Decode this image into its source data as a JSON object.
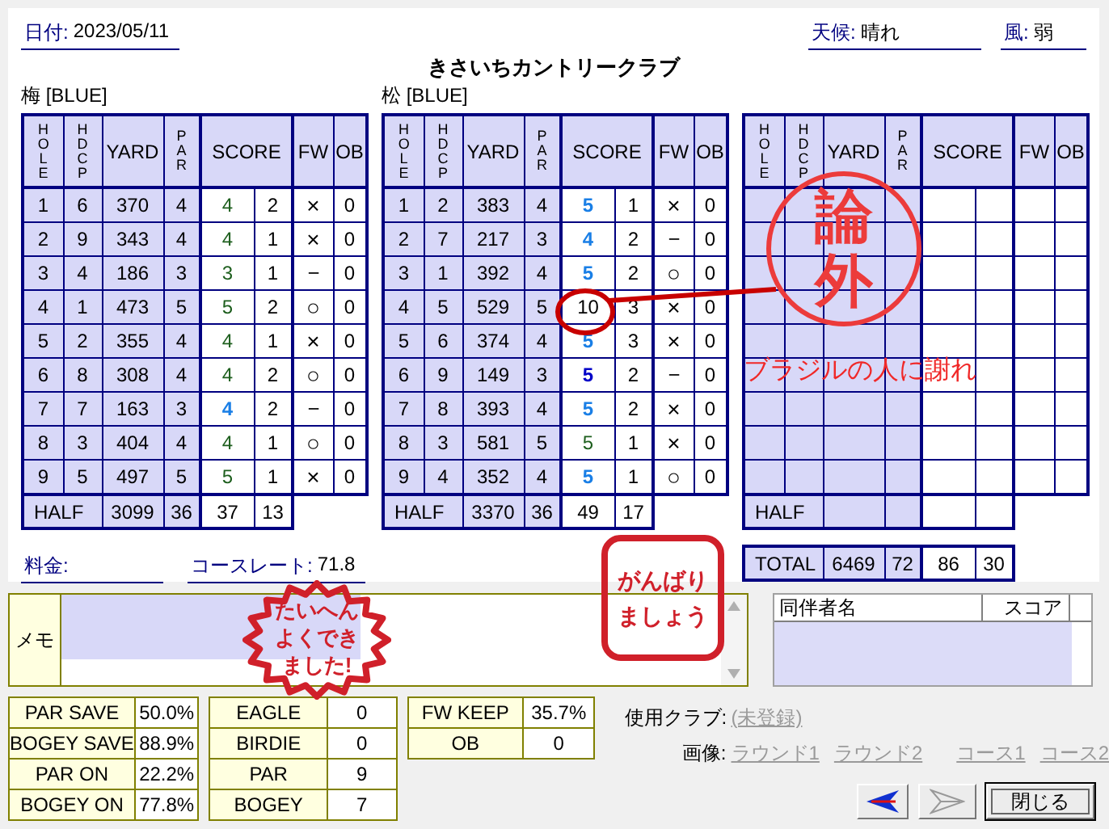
{
  "header": {
    "date_label": "日付:",
    "date": "2023/05/11",
    "weather_label": "天候:",
    "weather": "晴れ",
    "wind_label": "風:",
    "wind": "弱"
  },
  "title": "きさいちカントリークラブ",
  "courses": [
    {
      "name": "梅 [BLUE]",
      "columns": [
        {
          "label": "HOLE",
          "vertical": true
        },
        {
          "label": "HDCP",
          "vertical": true
        },
        {
          "label": "YARD",
          "vertical": false
        },
        {
          "label": "PAR",
          "vertical": true
        },
        {
          "label": "SCORE",
          "vertical": false
        },
        {
          "label": "FW",
          "vertical": false
        },
        {
          "label": "OB",
          "vertical": false
        }
      ],
      "holes": [
        {
          "hole": "1",
          "hdcp": "6",
          "yard": "370",
          "par": "4",
          "score": "4",
          "color": "#1d5e1d",
          "bold": false,
          "putts": "2",
          "fw": "×",
          "ob": "0"
        },
        {
          "hole": "2",
          "hdcp": "9",
          "yard": "343",
          "par": "4",
          "score": "4",
          "color": "#1d5e1d",
          "bold": false,
          "putts": "1",
          "fw": "×",
          "ob": "0"
        },
        {
          "hole": "3",
          "hdcp": "4",
          "yard": "186",
          "par": "3",
          "score": "3",
          "color": "#1d5e1d",
          "bold": false,
          "putts": "1",
          "fw": "－",
          "ob": "0"
        },
        {
          "hole": "4",
          "hdcp": "1",
          "yard": "473",
          "par": "5",
          "score": "5",
          "color": "#1d5e1d",
          "bold": false,
          "putts": "2",
          "fw": "○",
          "ob": "0"
        },
        {
          "hole": "5",
          "hdcp": "2",
          "yard": "355",
          "par": "4",
          "score": "4",
          "color": "#1d5e1d",
          "bold": false,
          "putts": "1",
          "fw": "×",
          "ob": "0"
        },
        {
          "hole": "6",
          "hdcp": "8",
          "yard": "308",
          "par": "4",
          "score": "4",
          "color": "#1d5e1d",
          "bold": false,
          "putts": "2",
          "fw": "○",
          "ob": "0"
        },
        {
          "hole": "7",
          "hdcp": "7",
          "yard": "163",
          "par": "3",
          "score": "4",
          "color": "#1a7fe6",
          "bold": true,
          "putts": "2",
          "fw": "－",
          "ob": "0"
        },
        {
          "hole": "8",
          "hdcp": "3",
          "yard": "404",
          "par": "4",
          "score": "4",
          "color": "#1d5e1d",
          "bold": false,
          "putts": "1",
          "fw": "○",
          "ob": "0"
        },
        {
          "hole": "9",
          "hdcp": "5",
          "yard": "497",
          "par": "5",
          "score": "5",
          "color": "#1d5e1d",
          "bold": false,
          "putts": "1",
          "fw": "×",
          "ob": "0"
        }
      ],
      "half": {
        "label": "HALF",
        "yard": "3099",
        "par": "36",
        "score": "37",
        "putts": "13"
      }
    },
    {
      "name": "松 [BLUE]",
      "columns": [
        {
          "label": "HOLE",
          "vertical": true
        },
        {
          "label": "HDCP",
          "vertical": true
        },
        {
          "label": "YARD",
          "vertical": false
        },
        {
          "label": "PAR",
          "vertical": true
        },
        {
          "label": "SCORE",
          "vertical": false
        },
        {
          "label": "FW",
          "vertical": false
        },
        {
          "label": "OB",
          "vertical": false
        }
      ],
      "holes": [
        {
          "hole": "1",
          "hdcp": "2",
          "yard": "383",
          "par": "4",
          "score": "5",
          "color": "#1a7fe6",
          "bold": true,
          "putts": "1",
          "fw": "×",
          "ob": "0"
        },
        {
          "hole": "2",
          "hdcp": "7",
          "yard": "217",
          "par": "3",
          "score": "4",
          "color": "#1a7fe6",
          "bold": true,
          "putts": "2",
          "fw": "－",
          "ob": "0"
        },
        {
          "hole": "3",
          "hdcp": "1",
          "yard": "392",
          "par": "4",
          "score": "5",
          "color": "#1a7fe6",
          "bold": true,
          "putts": "2",
          "fw": "○",
          "ob": "0"
        },
        {
          "hole": "4",
          "hdcp": "5",
          "yard": "529",
          "par": "5",
          "score": "10",
          "color": "#000000",
          "bold": false,
          "putts": "3",
          "fw": "×",
          "ob": "0"
        },
        {
          "hole": "5",
          "hdcp": "6",
          "yard": "374",
          "par": "4",
          "score": "5",
          "color": "#1a7fe6",
          "bold": true,
          "putts": "3",
          "fw": "×",
          "ob": "0"
        },
        {
          "hole": "6",
          "hdcp": "9",
          "yard": "149",
          "par": "3",
          "score": "5",
          "color": "#0000c8",
          "bold": true,
          "putts": "2",
          "fw": "－",
          "ob": "0"
        },
        {
          "hole": "7",
          "hdcp": "8",
          "yard": "393",
          "par": "4",
          "score": "5",
          "color": "#1a7fe6",
          "bold": true,
          "putts": "2",
          "fw": "×",
          "ob": "0"
        },
        {
          "hole": "8",
          "hdcp": "3",
          "yard": "581",
          "par": "5",
          "score": "5",
          "color": "#1d5e1d",
          "bold": false,
          "putts": "1",
          "fw": "×",
          "ob": "0"
        },
        {
          "hole": "9",
          "hdcp": "4",
          "yard": "352",
          "par": "4",
          "score": "5",
          "color": "#1a7fe6",
          "bold": true,
          "putts": "1",
          "fw": "○",
          "ob": "0"
        }
      ],
      "half": {
        "label": "HALF",
        "yard": "3370",
        "par": "36",
        "score": "49",
        "putts": "17"
      }
    },
    {
      "columns": [
        {
          "label": "HOLE",
          "vertical": true
        },
        {
          "label": "HDCP",
          "vertical": true
        },
        {
          "label": "YARD",
          "vertical": false
        },
        {
          "label": "PAR",
          "vertical": true
        },
        {
          "label": "SCORE",
          "vertical": false
        },
        {
          "label": "FW",
          "vertical": false
        },
        {
          "label": "OB",
          "vertical": false
        }
      ],
      "half": {
        "label": "HALF"
      }
    }
  ],
  "total": {
    "label": "TOTAL",
    "yard": "6469",
    "par": "72",
    "score": "86",
    "putts": "30"
  },
  "fee": {
    "label": "料金:"
  },
  "course_rating": {
    "label": "コースレート:",
    "value": "71.8"
  },
  "memo": {
    "label": "メモ"
  },
  "companions": {
    "columns": [
      "同伴者名",
      "スコア"
    ]
  },
  "stat_tables": [
    {
      "rows": [
        {
          "label": "PAR SAVE",
          "value": "50.0%"
        },
        {
          "label": "BOGEY SAVE",
          "value": "88.9%"
        },
        {
          "label": "PAR ON",
          "value": "22.2%"
        },
        {
          "label": "BOGEY ON",
          "value": "77.8%"
        }
      ]
    },
    {
      "rows": [
        {
          "label": "EAGLE",
          "value": "0"
        },
        {
          "label": "BIRDIE",
          "value": "0"
        },
        {
          "label": "PAR",
          "value": "9"
        },
        {
          "label": "BOGEY",
          "value": "7"
        }
      ]
    },
    {
      "rows": [
        {
          "label": "FW KEEP",
          "value": "35.7%"
        },
        {
          "label": "OB",
          "value": "0"
        }
      ]
    }
  ],
  "clubs": {
    "label": "使用クラブ:",
    "value": "(未登録)",
    "disabled": true
  },
  "images": {
    "label": "画像:",
    "links": [
      {
        "label": "ラウンド1",
        "disabled": true
      },
      {
        "label": "ラウンド2",
        "disabled": true
      },
      {
        "label": "コース1",
        "disabled": true
      },
      {
        "label": "コース2",
        "disabled": true
      }
    ]
  },
  "buttons": [
    {
      "kind": "back",
      "disabled": false
    },
    {
      "kind": "forward",
      "disabled": true
    },
    {
      "kind": "text",
      "label": "閉じる",
      "focused": true
    }
  ],
  "stamps": [
    {
      "kind": "circle",
      "text": "論外"
    },
    {
      "kind": "starburst",
      "lines": [
        "たいへん",
        "よくでき",
        "ました!"
      ]
    },
    {
      "kind": "rounded",
      "lines": [
        "がんばり",
        "ましょう"
      ]
    }
  ],
  "annotation": {
    "caption": "ブラジルの人に謝れ"
  }
}
